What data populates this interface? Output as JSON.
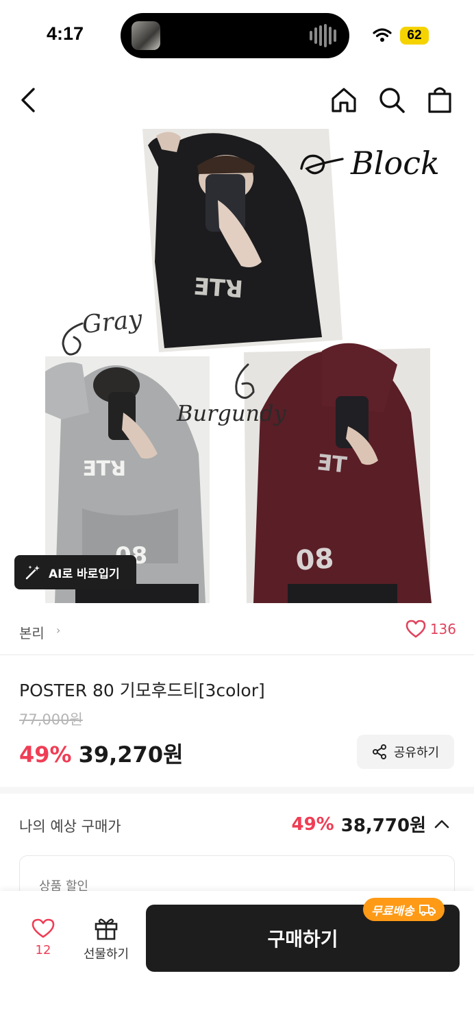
{
  "status": {
    "time": "4:17",
    "battery": "62"
  },
  "nav": {
    "back": "back-icon",
    "home": "home-icon",
    "search": "search-icon",
    "cart": "shopping-bag-icon"
  },
  "image": {
    "labels": {
      "black": "Block",
      "gray": "Gray",
      "burgundy": "Burgundy"
    },
    "colors": {
      "black": "#1c1c1e",
      "gray": "#a9abac",
      "burgundy": "#5a1e26"
    }
  },
  "ai_button": {
    "label": "AI로 바로입기"
  },
  "brand": {
    "name": "본리",
    "likes": "136"
  },
  "product": {
    "title": "POSTER 80 기모후드티[3color]",
    "original_price": "77,000원",
    "discount": "49%",
    "price": "39,270원"
  },
  "share": {
    "label": "공유하기"
  },
  "expected": {
    "label": "나의 예상 구매가",
    "discount": "49%",
    "price": "38,770원"
  },
  "discount_card": {
    "label": "상품 할인"
  },
  "bottom": {
    "wish_count": "12",
    "gift_label": "선물하기",
    "buy_label": "구매하기",
    "badge": "무료배송"
  },
  "colors": {
    "accent": "#ef3d55",
    "badge": "#ff9a16",
    "button": "#1d1d1d"
  }
}
